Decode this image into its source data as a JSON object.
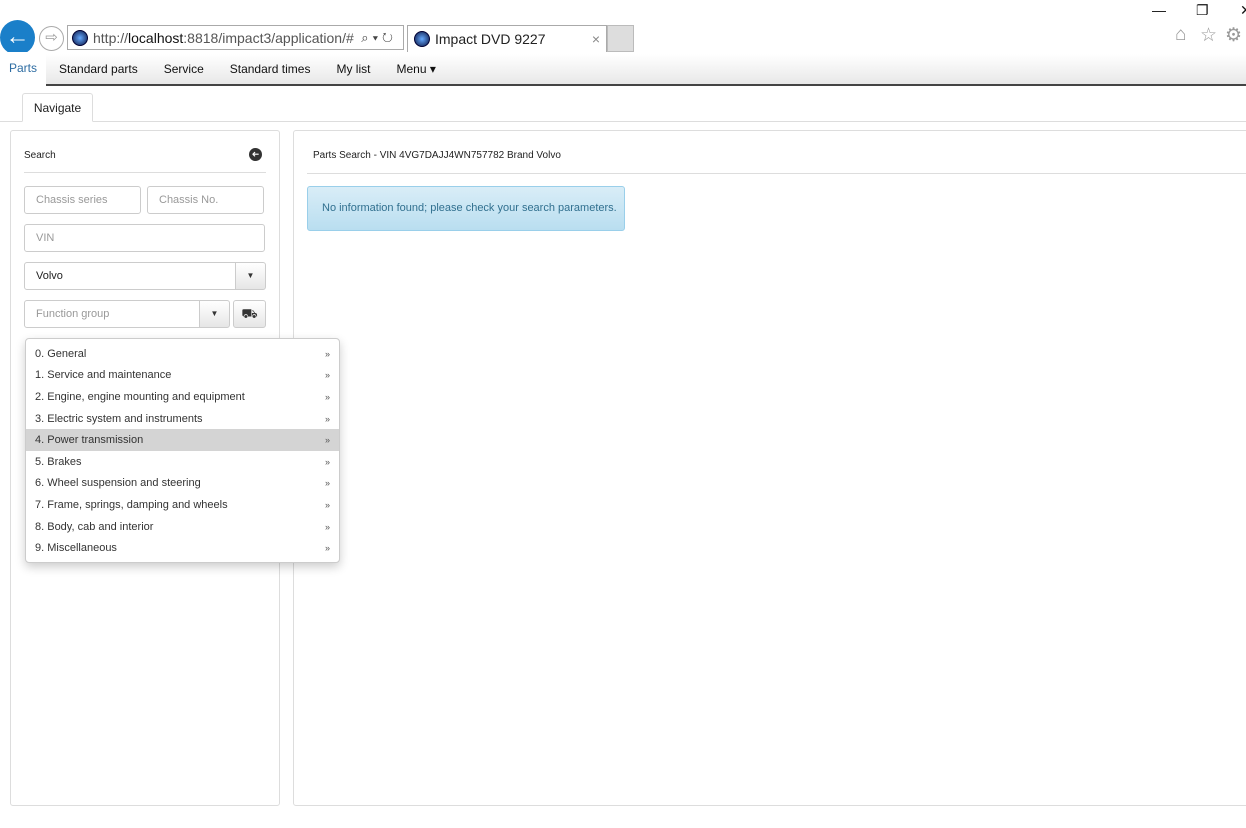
{
  "browser": {
    "url_prefix": "http://",
    "url_host": "localhost",
    "url_rest": ":8818/impact3/application/#",
    "tab_title": "Impact DVD 9227",
    "tab_close": "×",
    "back_icon": "←",
    "forward_icon": "⇨",
    "address_tools": "⌕▾↻",
    "minimize": "—",
    "restore": "❐",
    "close": "✕",
    "home_icon": "⌂",
    "star_icon": "☆",
    "gear_icon": "⚙"
  },
  "nav": {
    "items": [
      "Parts",
      "Standard parts",
      "Service",
      "Standard times",
      "My list",
      "Menu ▾"
    ],
    "active": "Parts"
  },
  "subtabs": {
    "navigate": "Navigate"
  },
  "search": {
    "title": "Search",
    "collapse_icon": "➜",
    "chassis_series_placeholder": "Chassis series",
    "chassis_no_placeholder": "Chassis No.",
    "vin_placeholder": "VIN",
    "brand_value": "Volvo",
    "function_group_placeholder": "Function group",
    "caret": "▼",
    "truck_icon": "⛟"
  },
  "results": {
    "header": "Parts Search - VIN 4VG7DAJJ4WN757782 Brand Volvo",
    "alert": "No information found; please check your search parameters."
  },
  "function_group_menu": {
    "highlighted_index": 4,
    "arrow": "»",
    "items": [
      "0. General",
      "1. Service and maintenance",
      "2. Engine, engine mounting and equipment",
      "3. Electric system and instruments",
      "4. Power transmission",
      "5. Brakes",
      "6. Wheel suspension and steering",
      "7. Frame, springs, damping and wheels",
      "8. Body, cab and interior",
      "9. Miscellaneous"
    ]
  },
  "colors": {
    "accent": "#2d6ca2",
    "alert_text": "#31708f",
    "alert_bg": "#d9edf7",
    "back_button": "#1a7fc9"
  }
}
